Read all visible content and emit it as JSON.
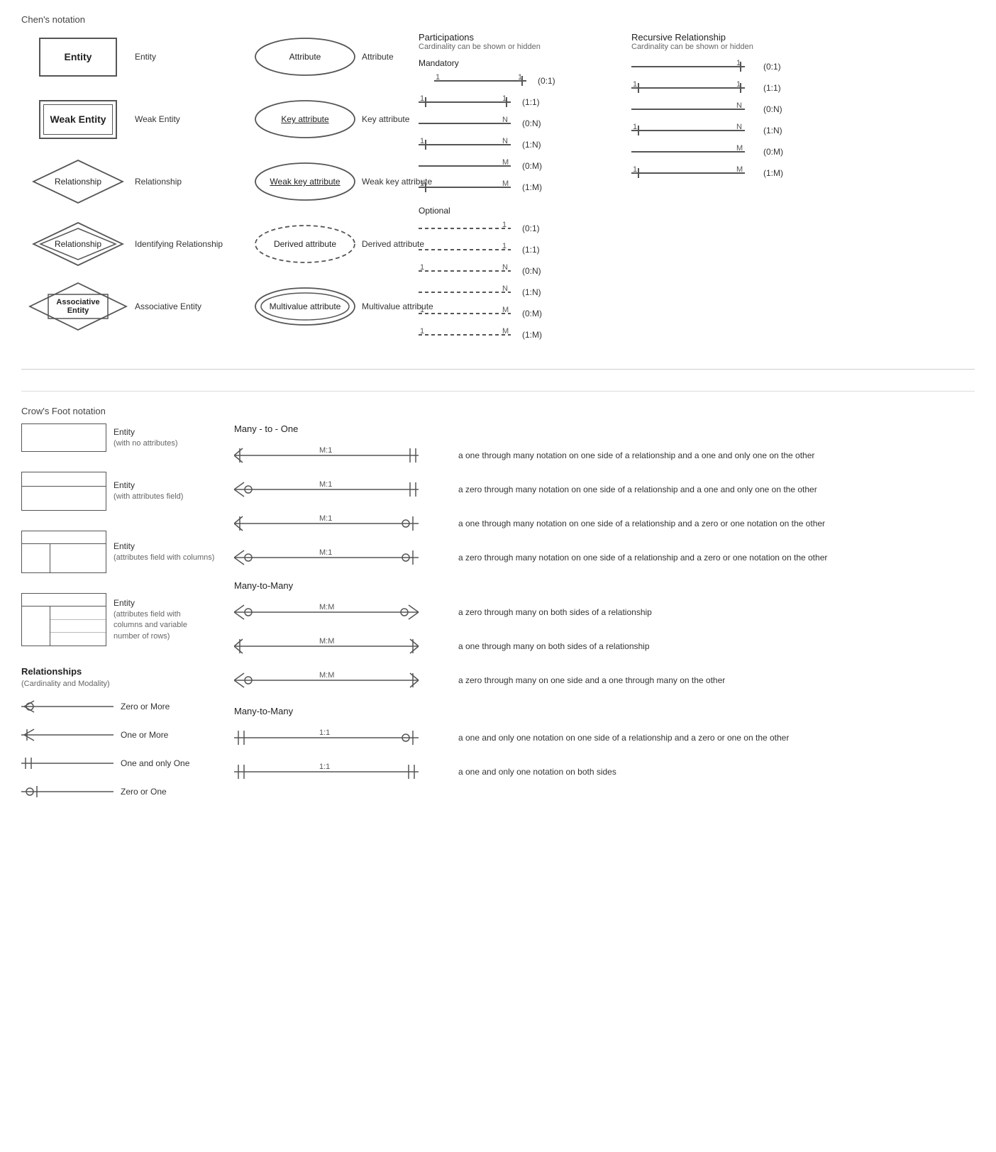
{
  "chens": {
    "section_title": "Chen's notation",
    "rows": [
      {
        "symbol_type": "entity",
        "symbol_label": "Entity",
        "label": "Entity"
      },
      {
        "symbol_type": "weak_entity",
        "symbol_label": "Weak Entity",
        "label": "Weak Entity"
      },
      {
        "symbol_type": "relationship",
        "symbol_label": "Relationship",
        "label": "Relationship"
      },
      {
        "symbol_type": "identifying_relationship",
        "symbol_label": "Relationship",
        "label": "Identifying Relationship"
      },
      {
        "symbol_type": "associative_entity",
        "symbol_label": "Associative Entity",
        "label": "Associative Entity"
      }
    ],
    "attr_rows": [
      {
        "symbol_type": "ellipse",
        "symbol_label": "Attribute",
        "label": "Attribute"
      },
      {
        "symbol_type": "key_attribute",
        "symbol_label": "Key attribute",
        "label": "Key attribute"
      },
      {
        "symbol_type": "weak_key_attribute",
        "symbol_label": "Weak key attribute",
        "label": "Weak key attribute"
      },
      {
        "symbol_type": "derived_attribute",
        "symbol_label": "Derived attribute",
        "label": "Derived attribute"
      },
      {
        "symbol_type": "multivalue_attribute",
        "symbol_label": "Multivalue attribute",
        "label": "Multivalue attribute"
      }
    ]
  },
  "participations": {
    "title": "Participations",
    "subtitle": "Cardinality can be shown or hidden",
    "mandatory_label": "Mandatory",
    "mandatory_rows": [
      {
        "left": "1",
        "right": "1",
        "notation": "(0:1)"
      },
      {
        "left": "1",
        "right": "1",
        "notation": "(1:1)"
      },
      {
        "left": "",
        "right": "N",
        "notation": "(0:N)"
      },
      {
        "left": "1",
        "right": "N",
        "notation": "(1:N)"
      },
      {
        "left": "",
        "right": "M",
        "notation": "(0:M)"
      },
      {
        "left": "1",
        "right": "M",
        "notation": "(1:M)"
      }
    ],
    "optional_label": "Optional",
    "optional_rows": [
      {
        "left": "",
        "right": "1",
        "notation": "(0:1)"
      },
      {
        "left": "",
        "right": "1",
        "notation": "(1:1)"
      },
      {
        "left": "1",
        "right": "N",
        "notation": "(0:N)"
      },
      {
        "left": "",
        "right": "N",
        "notation": "(1:N)"
      },
      {
        "left": "1",
        "right": "M",
        "notation": "(0:M)"
      },
      {
        "left": "1",
        "right": "M",
        "notation": "(1:M)"
      }
    ]
  },
  "recursive": {
    "title": "Recursive Relationship",
    "subtitle": "Cardinality can be shown or hidden",
    "rows": [
      {
        "left": "",
        "right": "1",
        "notation": "(0:1)"
      },
      {
        "left": "1",
        "right": "1",
        "notation": "(1:1)"
      },
      {
        "left": "",
        "right": "N",
        "notation": "(0:N)"
      },
      {
        "left": "1",
        "right": "N",
        "notation": "(1:N)"
      },
      {
        "left": "",
        "right": "M",
        "notation": "(0:M)"
      },
      {
        "left": "1",
        "right": "M",
        "notation": "(1:M)"
      }
    ]
  },
  "crows_foot": {
    "section_title": "Crow's Foot notation",
    "entities": [
      {
        "type": "simple",
        "label": "Entity",
        "sublabel": "(with no attributes)"
      },
      {
        "type": "attr",
        "label": "Entity",
        "sublabel": "(with attributes field)"
      },
      {
        "type": "col",
        "label": "Entity",
        "sublabel": "(attributes field with columns)"
      },
      {
        "type": "varrow",
        "label": "Entity",
        "sublabel": "(attributes field with columns and variable number of rows)"
      }
    ],
    "relationships": {
      "title": "Relationships",
      "subtitle": "(Cardinality and Modality)",
      "items": [
        {
          "type": "zero_more",
          "label": "Zero or More"
        },
        {
          "type": "one_more",
          "label": "One or More"
        },
        {
          "type": "one_only",
          "label": "One and only One"
        },
        {
          "type": "zero_one",
          "label": "Zero or One"
        }
      ]
    },
    "many_to_one": {
      "title": "Many - to - One",
      "rows": [
        {
          "label": "M:1",
          "desc": "a one through many notation on one side of a relationship and a one and only one on the other"
        },
        {
          "label": "M:1",
          "desc": "a zero through many notation on one side of a relationship and a one and only one on the other"
        },
        {
          "label": "M:1",
          "desc": "a one through many notation on one side of a relationship and a zero or one notation on the other"
        },
        {
          "label": "M:1",
          "desc": "a zero through many notation on one side of a relationship and a zero or one notation on the other"
        }
      ]
    },
    "many_to_many": {
      "title": "Many-to-Many",
      "rows": [
        {
          "label": "M:M",
          "desc": "a zero through many on both sides of a relationship"
        },
        {
          "label": "M:M",
          "desc": "a one through many on both sides of a relationship"
        },
        {
          "label": "M:M",
          "desc": "a zero through many on one side and a one through many on the other"
        }
      ]
    },
    "one_to_one": {
      "title": "Many-to-Many",
      "rows": [
        {
          "label": "1:1",
          "desc": "a one and only one notation on one side of a relationship and a zero or one on the other"
        },
        {
          "label": "1:1",
          "desc": "a one and only one notation on both sides"
        }
      ]
    }
  }
}
